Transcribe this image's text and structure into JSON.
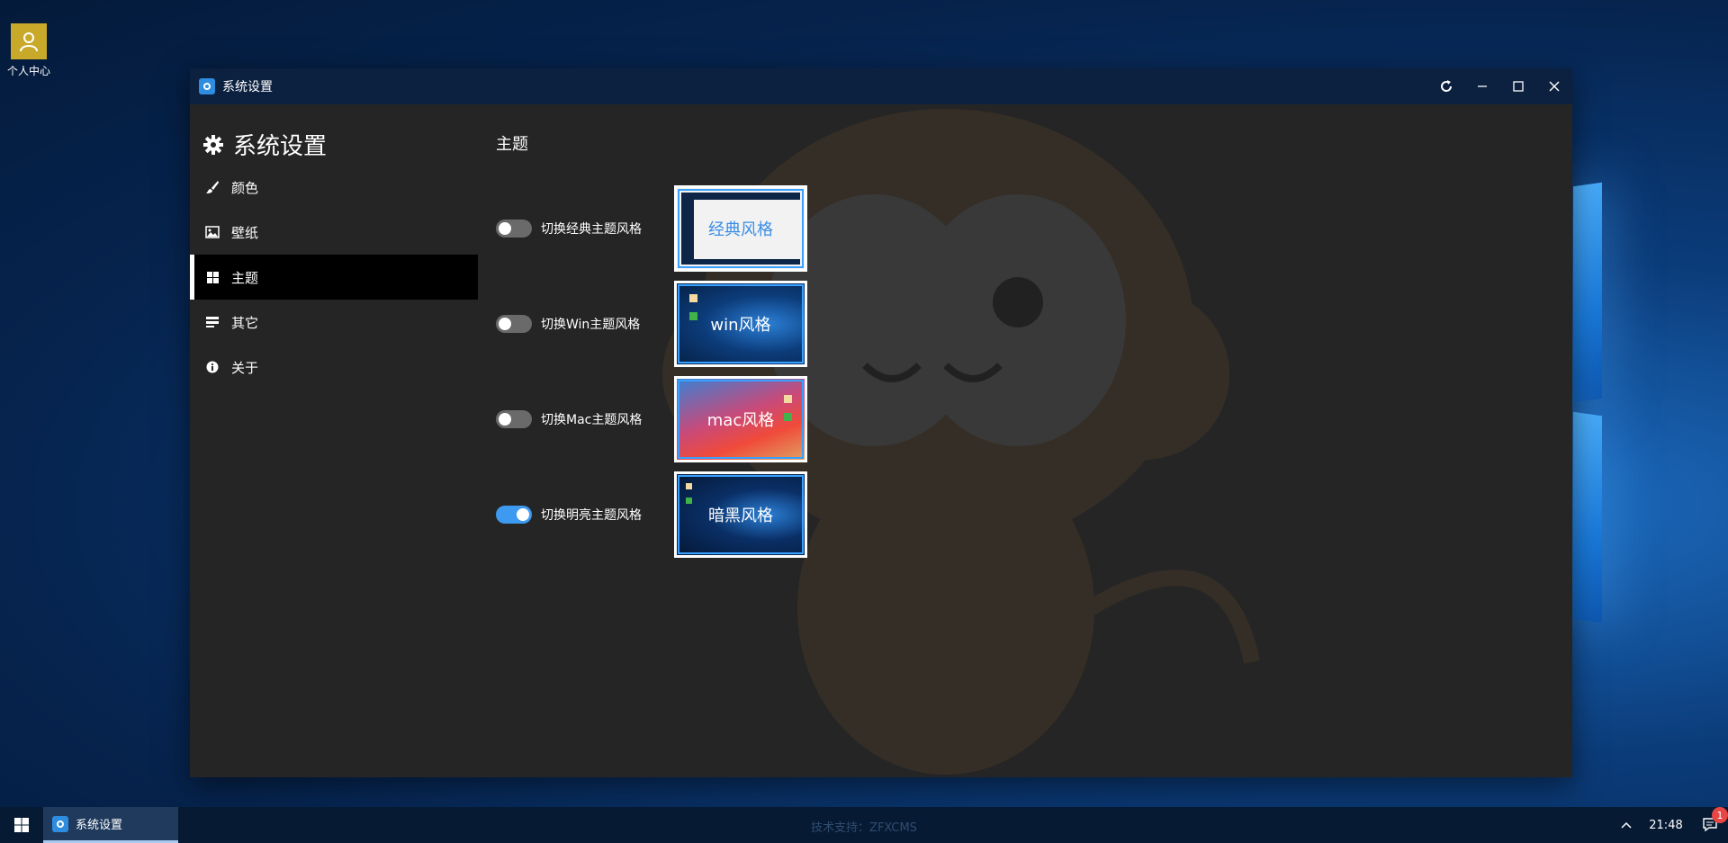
{
  "desktop": {
    "icons": [
      {
        "label": "个人中心",
        "icon": "user-icon"
      }
    ]
  },
  "window": {
    "title": "系统设置",
    "controls": [
      "refresh-icon",
      "minimize-icon",
      "maximize-icon",
      "close-icon"
    ]
  },
  "sidebar": {
    "header": "系统设置",
    "items": [
      {
        "label": "颜色",
        "icon": "brush-icon",
        "active": false
      },
      {
        "label": "壁纸",
        "icon": "image-icon",
        "active": false
      },
      {
        "label": "主题",
        "icon": "windows-icon",
        "active": true
      },
      {
        "label": "其它",
        "icon": "list-icon",
        "active": false
      },
      {
        "label": "关于",
        "icon": "info-icon",
        "active": false
      }
    ]
  },
  "main": {
    "section_title": "主题",
    "themes": [
      {
        "label": "切换经典主题风格",
        "thumb_label": "经典风格",
        "enabled": false
      },
      {
        "label": "切换Win主题风格",
        "thumb_label": "win风格",
        "enabled": false
      },
      {
        "label": "切换Mac主题风格",
        "thumb_label": "mac风格",
        "enabled": false
      },
      {
        "label": "切换明亮主题风格",
        "thumb_label": "暗黑风格",
        "enabled": true
      }
    ]
  },
  "taskbar": {
    "task_label": "系统设置",
    "support_text": "技术支持：ZFXCMS",
    "clock": "21:48",
    "notification_count": "1"
  },
  "colors": {
    "accent": "#3d9af0",
    "titlebar": "#0c2140",
    "window_bg": "#252525",
    "active_nav": "#000000"
  }
}
